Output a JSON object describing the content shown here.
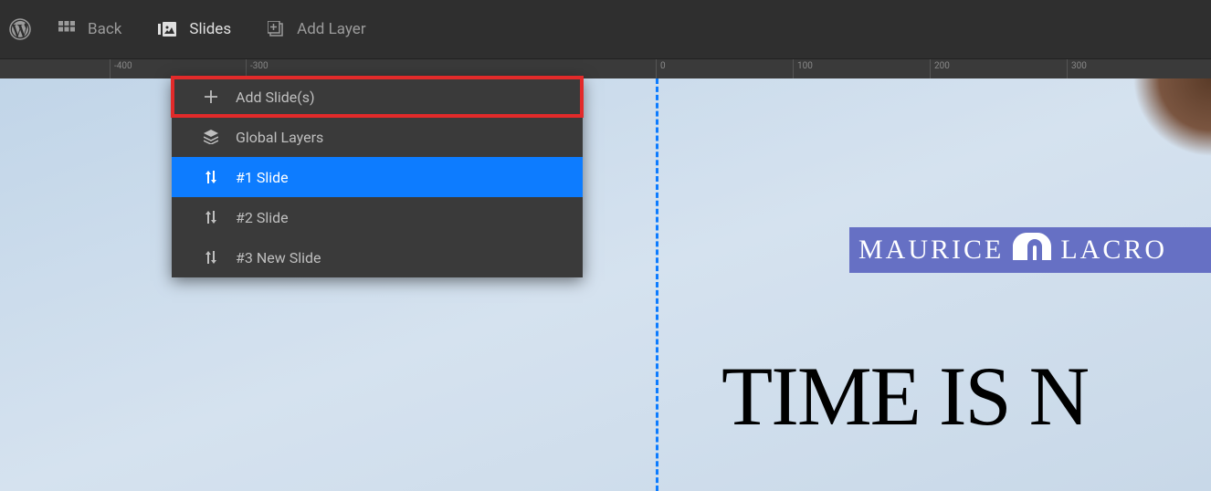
{
  "toolbar": {
    "back_label": "Back",
    "slides_label": "Slides",
    "add_layer_label": "Add Layer"
  },
  "ruler": {
    "marks": [
      {
        "pos": 120,
        "label": "-400"
      },
      {
        "pos": 269,
        "label": "-300"
      },
      {
        "pos": 718,
        "label": "0"
      },
      {
        "pos": 868,
        "label": "100"
      },
      {
        "pos": 1018,
        "label": "200"
      },
      {
        "pos": 1168,
        "label": "300"
      }
    ]
  },
  "dropdown": {
    "add_slides": "Add Slide(s)",
    "global_layers": "Global Layers",
    "slide1": "#1 Slide",
    "slide2": "#2 Slide",
    "slide3": "#3 New Slide"
  },
  "slide_content": {
    "logo_text_left": "MAURICE",
    "logo_text_right": "LACRO",
    "headline": "TIME IS N"
  },
  "colors": {
    "accent": "#0d7cff",
    "highlight_outline": "#e22a2a",
    "logo_bg": "#6670c4"
  }
}
